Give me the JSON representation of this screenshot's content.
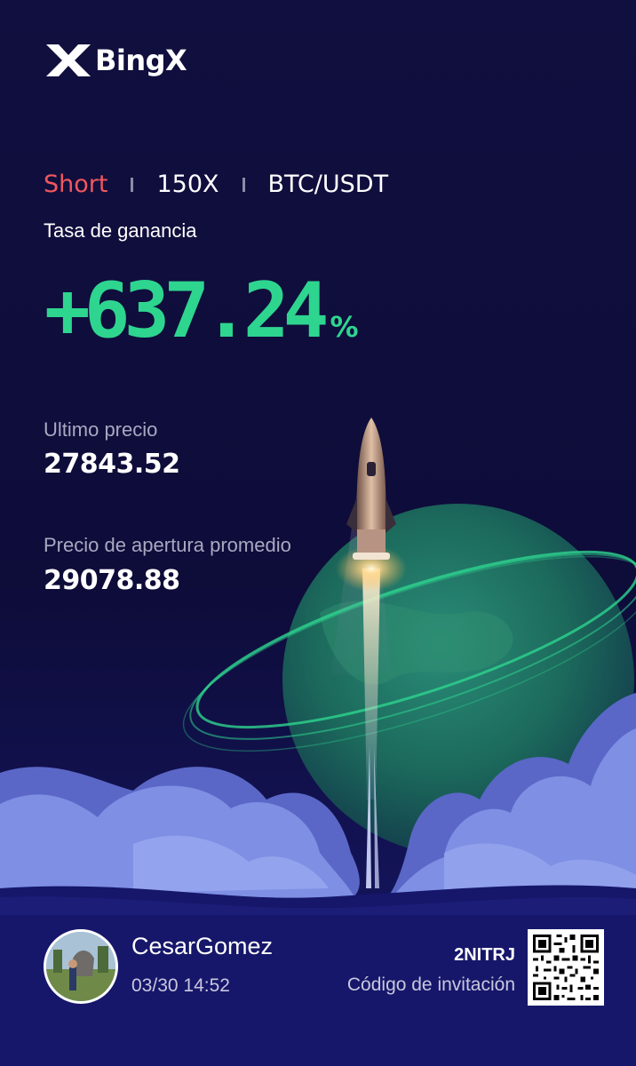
{
  "brand": {
    "name": "BingX"
  },
  "trade": {
    "direction": "Short",
    "leverage": "150X",
    "pair": "BTC/USDT"
  },
  "profit": {
    "label": "Tasa de ganancia",
    "value": "+637.24",
    "unit": "%"
  },
  "last_price": {
    "label": "Ultimo precio",
    "value": "27843.52"
  },
  "open_price": {
    "label": "Precio de apertura promedio",
    "value": "29078.88"
  },
  "user": {
    "name": "CesarGomez",
    "datetime": "03/30 14:52"
  },
  "invite": {
    "code": "2NITRJ",
    "label": "Código de invitación"
  },
  "colors": {
    "background": "#110f3f",
    "short": "#f0575d",
    "profit": "#2ed58f",
    "planet": "#1f7a6a",
    "clouds": "#7e8fe4"
  },
  "icons": [
    "bingx-logo-icon",
    "rocket-illustration",
    "planet-illustration",
    "clouds-illustration",
    "qr-code-icon"
  ]
}
